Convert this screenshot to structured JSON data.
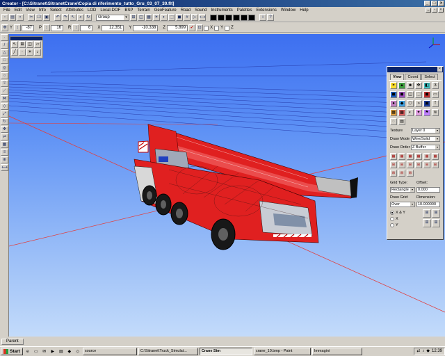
{
  "window": {
    "title": "Creator - [C:\\Sitranet\\SitranetCrane\\Copia di riferimento_tutto_Gru_03_07_30.flt]"
  },
  "menu": [
    "File",
    "Edit",
    "View",
    "Info",
    "Select",
    "Attributes",
    "LOD",
    "Local-DOF",
    "BSP",
    "Terrain",
    "GeoFeature",
    "Road",
    "Sound",
    "Instruments",
    "Palettes",
    "Extensions",
    "Window",
    "Help"
  ],
  "toolbar2": {
    "group_combo": "Group"
  },
  "toolbar3": {
    "y_label": "Y",
    "y_value": "-87",
    "p_label": "P",
    "p_value": "16",
    "r_label": "R",
    "r_value": "6",
    "x_label": "X",
    "x_value": "12.351",
    "y2_label": "Y",
    "y2_value": "-10.338",
    "z_label": "Z",
    "z_value": "5.899",
    "chk_x": "X",
    "chk_y": "Y",
    "chk_z": "Z"
  },
  "palette": {
    "tabs": [
      "View",
      "Coord",
      "Select"
    ],
    "texture_label": "Texture",
    "texture_value": "Layer 0",
    "draw_mode_label": "Draw Mode",
    "draw_mode_value": "Wire/Solid",
    "draw_order_label": "Draw Order",
    "draw_order_value": "Z Buffer",
    "grid_type_label": "Grid Type:",
    "grid_type_value": "Rectangle",
    "offset_label": "Offset:",
    "offset_value": "0.000",
    "draw_grid_label": "Draw Grid:",
    "draw_grid_value": "Over",
    "dimension_label": "Dimension:",
    "dimension_value": "10.000000",
    "radio_xy": "X & Y",
    "radio_x": "X",
    "radio_y": "Y"
  },
  "status": {
    "parent_tab": "Parent"
  },
  "taskbar": {
    "start": "Start",
    "tasks": [
      "source",
      "C:\\Sitranet\\Truck_Simulat...",
      "Crane Sim",
      "crane_10.bmp - Paint",
      "Immagini"
    ],
    "active_task_index": 2,
    "clock": "12.39"
  },
  "colors": {
    "titlebar": "#0a246a",
    "sky_top": "#3d6ff0",
    "sky_bottom": "#c3dbfa",
    "crane_red": "#e02020"
  }
}
